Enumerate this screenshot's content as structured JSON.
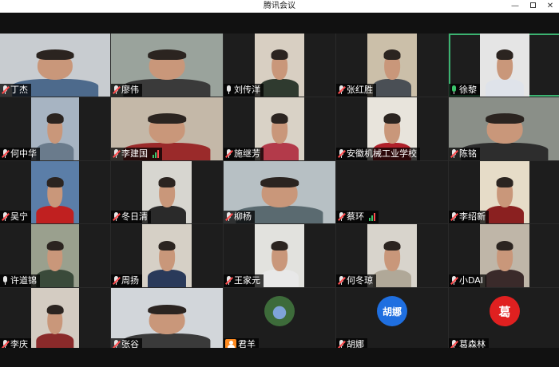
{
  "app": {
    "window_title": "腾讯会议"
  },
  "colors": {
    "mic_muted": "#ff4d4f",
    "mic_active": "#3cc46b",
    "active_speaker_border": "#3cb371",
    "host_badge": "#ff8a1f"
  },
  "participants": [
    {
      "name": "丁杰",
      "mic": "muted",
      "video": "full",
      "bg": "#c8ccd0",
      "shirt": "#4d6a8c"
    },
    {
      "name": "廖伟",
      "mic": "muted",
      "video": "full",
      "bg": "#9aa39c",
      "shirt": "#3a3a3a"
    },
    {
      "name": "刘传洋",
      "mic": "on",
      "video": "pillar",
      "bg": "#d8cfc2",
      "shirt": "#2f3a2f"
    },
    {
      "name": "张红胜",
      "mic": "muted",
      "video": "pillar",
      "bg": "#cbbfa9",
      "shirt": "#4a4f55"
    },
    {
      "name": "徐黎",
      "mic": "active",
      "video": "pillar",
      "bg": "#e5e5e5",
      "shirt": "#dfe3ea"
    },
    {
      "name": "何中华",
      "mic": "muted",
      "video": "pillar",
      "bg": "#a7b4c2",
      "shirt": "#6a7b8c"
    },
    {
      "name": "李建国",
      "mic": "muted",
      "signal": true,
      "video": "full",
      "bg": "#c4b8a8",
      "shirt": "#9a2a2a"
    },
    {
      "name": "施继芳",
      "mic": "muted",
      "video": "pillar",
      "bg": "#d9d2c6",
      "shirt": "#b33a4a"
    },
    {
      "name": "安徽机械工业学校",
      "mic": "muted",
      "video": "pillar",
      "bg": "#e8e4dc",
      "shirt": "#b0202a"
    },
    {
      "name": "陈铭",
      "mic": "muted",
      "video": "full",
      "bg": "#8a8f88",
      "shirt": "#2d2d2d"
    },
    {
      "name": "吴宁",
      "mic": "muted",
      "video": "pillar",
      "bg": "#5b7ea8",
      "shirt": "#c02020"
    },
    {
      "name": "冬日清",
      "mic": "muted",
      "video": "pillar",
      "bg": "#d7d6d0",
      "shirt": "#2a2a2a"
    },
    {
      "name": "柳杨",
      "mic": "muted",
      "video": "full",
      "bg": "#b7c0c4",
      "shirt": "#5a6a70"
    },
    {
      "name": "蔡环",
      "mic": "muted",
      "signal": true,
      "video": "none"
    },
    {
      "name": "李绍新",
      "mic": "muted",
      "video": "pillar",
      "bg": "#e6dcc8",
      "shirt": "#8a2020"
    },
    {
      "name": "许道锦",
      "mic": "on",
      "video": "pillar",
      "bg": "#9aa08e",
      "shirt": "#3a4a3a"
    },
    {
      "name": "周扬",
      "mic": "muted",
      "video": "pillar",
      "bg": "#d6d0c6",
      "shirt": "#2a3a5a"
    },
    {
      "name": "王家元",
      "mic": "muted",
      "video": "pillar",
      "bg": "#e2e2de",
      "shirt": "#e8e8e8"
    },
    {
      "name": "何冬琼",
      "mic": "muted",
      "video": "pillar",
      "bg": "#d8d4cc",
      "shirt": "#b0a898"
    },
    {
      "name": "小DAI",
      "mic": "muted",
      "video": "pillar",
      "bg": "#bfb6a8",
      "shirt": "#3a2a2a"
    },
    {
      "name": "李庆",
      "mic": "muted",
      "video": "pillar",
      "bg": "#d4ccc2",
      "shirt": "#8a2a2a"
    },
    {
      "name": "张谷",
      "mic": "muted",
      "video": "full",
      "bg": "#d2d6da",
      "shirt": "#3a3a3a"
    },
    {
      "name": "君羊",
      "mic": "none",
      "host": true,
      "video": "avatar",
      "avatar_style": "photo",
      "avatar_text": ""
    },
    {
      "name": "胡娜",
      "mic": "muted",
      "video": "avatar",
      "avatar_style": "blue",
      "avatar_text": "胡娜"
    },
    {
      "name": "葛森林",
      "mic": "muted",
      "video": "avatar",
      "avatar_style": "red",
      "avatar_text": "葛"
    }
  ]
}
